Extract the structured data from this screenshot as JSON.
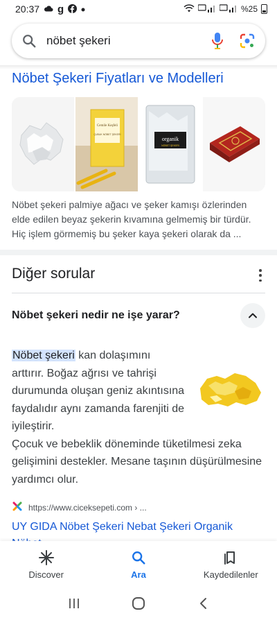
{
  "status_bar": {
    "time": "20:37",
    "battery": "%25"
  },
  "search": {
    "query": "nöbet şekeri"
  },
  "section": {
    "title": "Nöbet Şekeri Fiyatları ve Modelleri",
    "description": "Nöbet şekeri palmiye ağacı ve şeker kamışı özlerinden elde edilen beyaz şekerin kıvamına gelmemiş bir türdür. Hiç işlem görmemiş bu şeker kaya şekeri olarak da ...",
    "images": [
      "crystal-sugar-image",
      "yellow-sugar-package-image",
      "organik-package-image",
      "red-gift-box-image"
    ],
    "package_labels": {
      "organik": "organik",
      "organik_sub": "NÖBET ŞEKERİ",
      "yellow_brand": "Cemile Keşfeli",
      "yellow_product": "ÇUBUK NÖBET ŞEKERİ"
    }
  },
  "other_questions": {
    "title": "Diğer sorular",
    "question": "Nöbet şekeri nedir ne işe yarar?",
    "answer_highlight": "Nöbet şekeri",
    "answer_line1_rest": " kan dolaşımını",
    "answer_top_rest": "arttırır. Boğaz ağrısı ve tahrişi durumunda oluşan geniz akıntısına faydalıdır aynı zamanda farenjiti de iyileştirir.",
    "answer_bottom": "Çocuk ve bebeklik döneminde tüketilmesi zeka gelişimini destekler. Mesane taşının düşürülmesine yardımcı olur.",
    "source_url": "https://www.ciceksepeti.com › ...",
    "result_title": "UY GIDA Nöbet Şekeri Nebat Şekeri Organik Nöbet"
  },
  "bottom_nav": {
    "discover": "Discover",
    "search": "Ara",
    "saved": "Kaydedilenler"
  },
  "colors": {
    "link": "#1558d6",
    "active_nav": "#1a73e8",
    "highlight": "#d3e3fd"
  }
}
